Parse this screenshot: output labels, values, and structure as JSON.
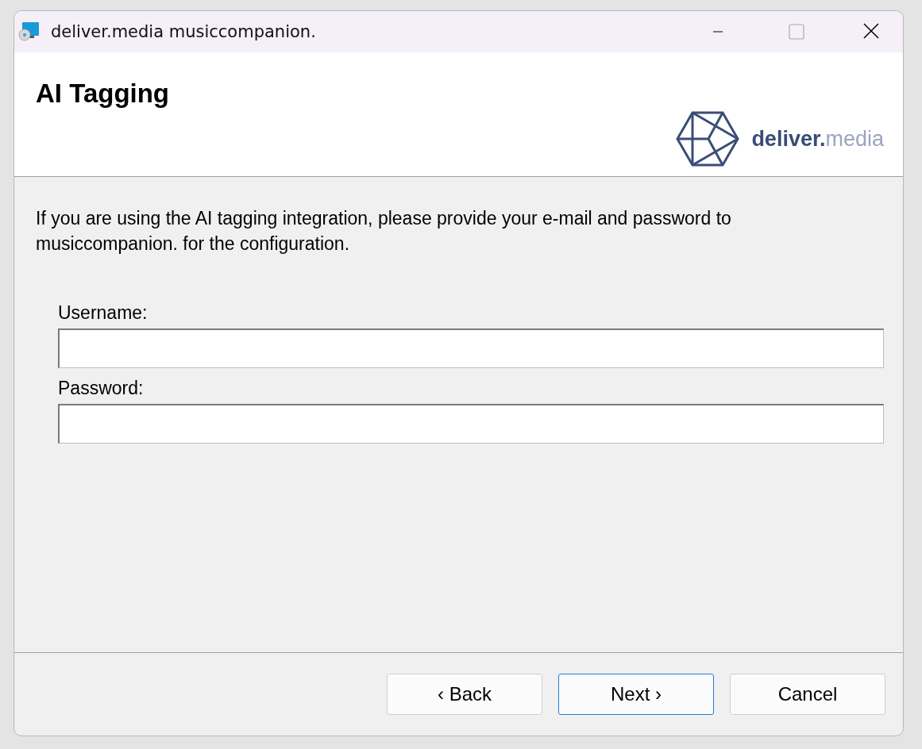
{
  "window": {
    "title": "deliver.media musiccompanion."
  },
  "header": {
    "title": "AI Tagging",
    "logo_text": "**deliver.**media"
  },
  "description": "If you are using the AI tagging integration, please provide your e-mail and password to musiccompanion. for the configuration.",
  "fields": [
    {
      "label": "Username:"
    },
    {
      "label": "Password:"
    }
  ],
  "buttons": [
    {
      "label": "‹ Back",
      "focused": false
    },
    {
      "label": "Next ›",
      "focused": true
    },
    {
      "label": "Cancel",
      "focused": false
    }
  ]
}
